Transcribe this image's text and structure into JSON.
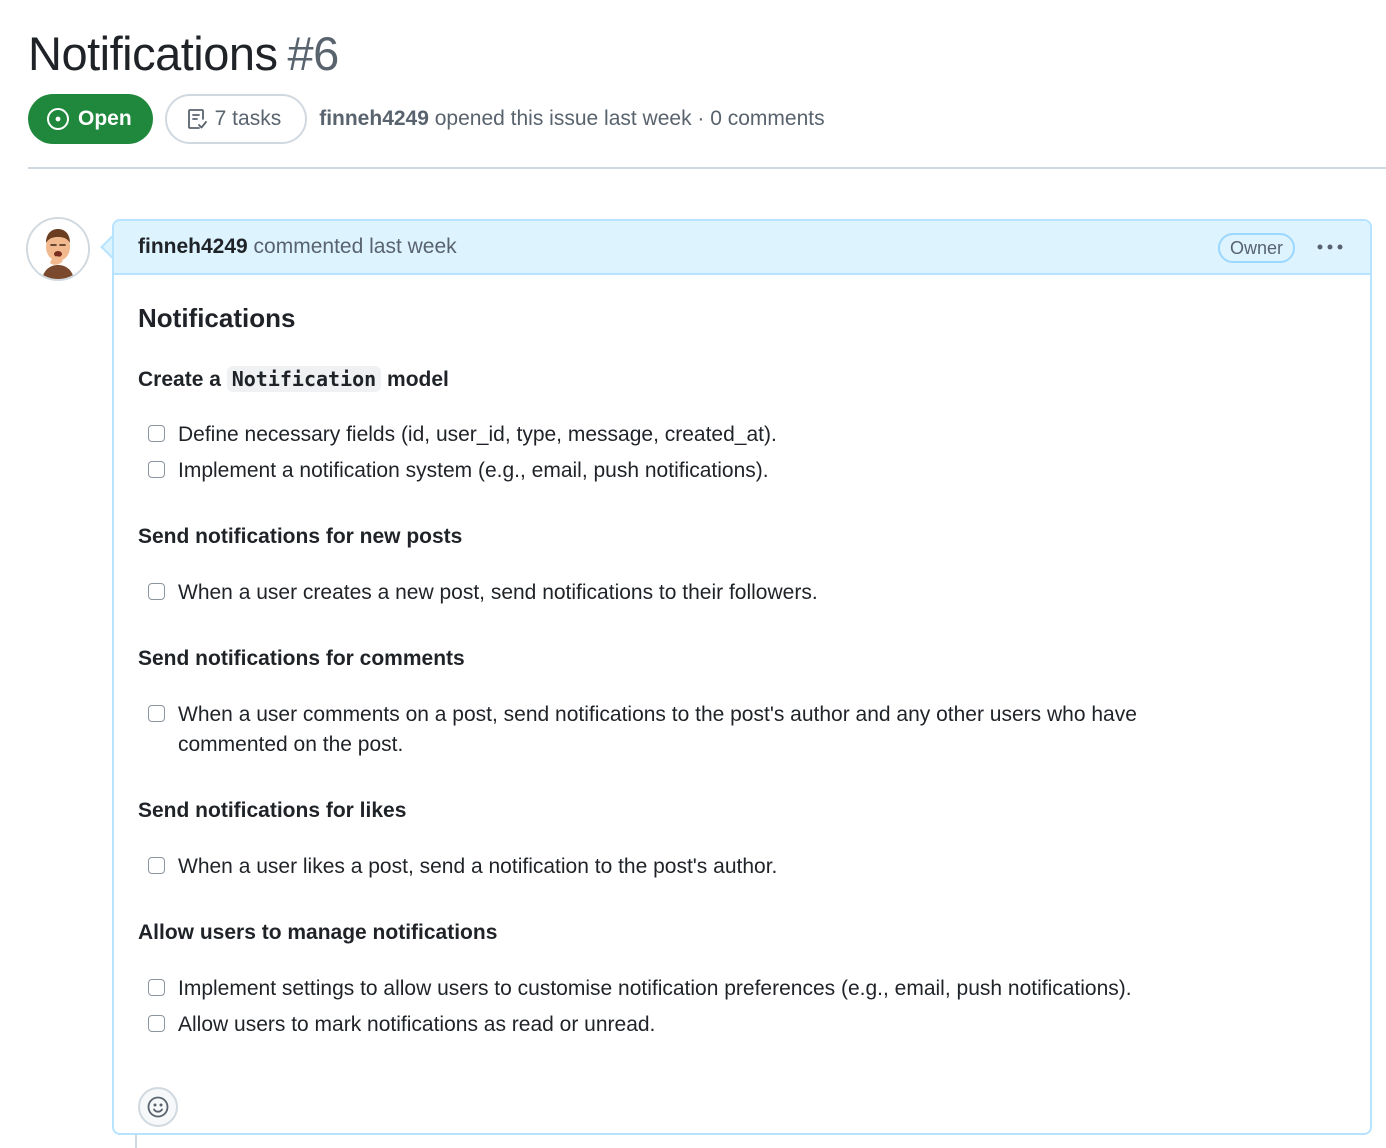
{
  "issue": {
    "title": "Notifications",
    "number": "#6",
    "state": "Open",
    "tasks": "7 tasks",
    "author": "finneh4249",
    "meta": " opened this issue last week · 0 comments"
  },
  "colors": {
    "open_green": "#1f883d",
    "header_blue": "#ddf4ff",
    "border_blue": "#b6e3ff",
    "muted": "#59636e"
  },
  "comment": {
    "author": "finneh4249",
    "meta": " commented last week",
    "badge": "Owner",
    "menu_icon": "kebab-horizontal-icon",
    "heading": "Notifications",
    "sections": [
      {
        "pre": "Create a ",
        "code": "Notification",
        "post": " model",
        "tasks": [
          "Define necessary fields (id, user_id, type, message, created_at).",
          "Implement a notification system (e.g., email, push notifications)."
        ]
      },
      {
        "title": "Send notifications for new posts",
        "tasks": [
          "When a user creates a new post, send notifications to their followers."
        ]
      },
      {
        "title": "Send notifications for comments",
        "tasks": [
          "When a user comments on a post, send notifications to the post's author and any other users who have commented on the post."
        ]
      },
      {
        "title": "Send notifications for likes",
        "tasks": [
          "When a user likes a post, send a notification to the post's author."
        ]
      },
      {
        "title": "Allow users to manage notifications",
        "tasks": [
          "Implement settings to allow users to customise notification preferences (e.g., email, push notifications).",
          "Allow users to mark notifications as read or unread."
        ]
      }
    ],
    "reaction_icon": "smiley-icon"
  }
}
